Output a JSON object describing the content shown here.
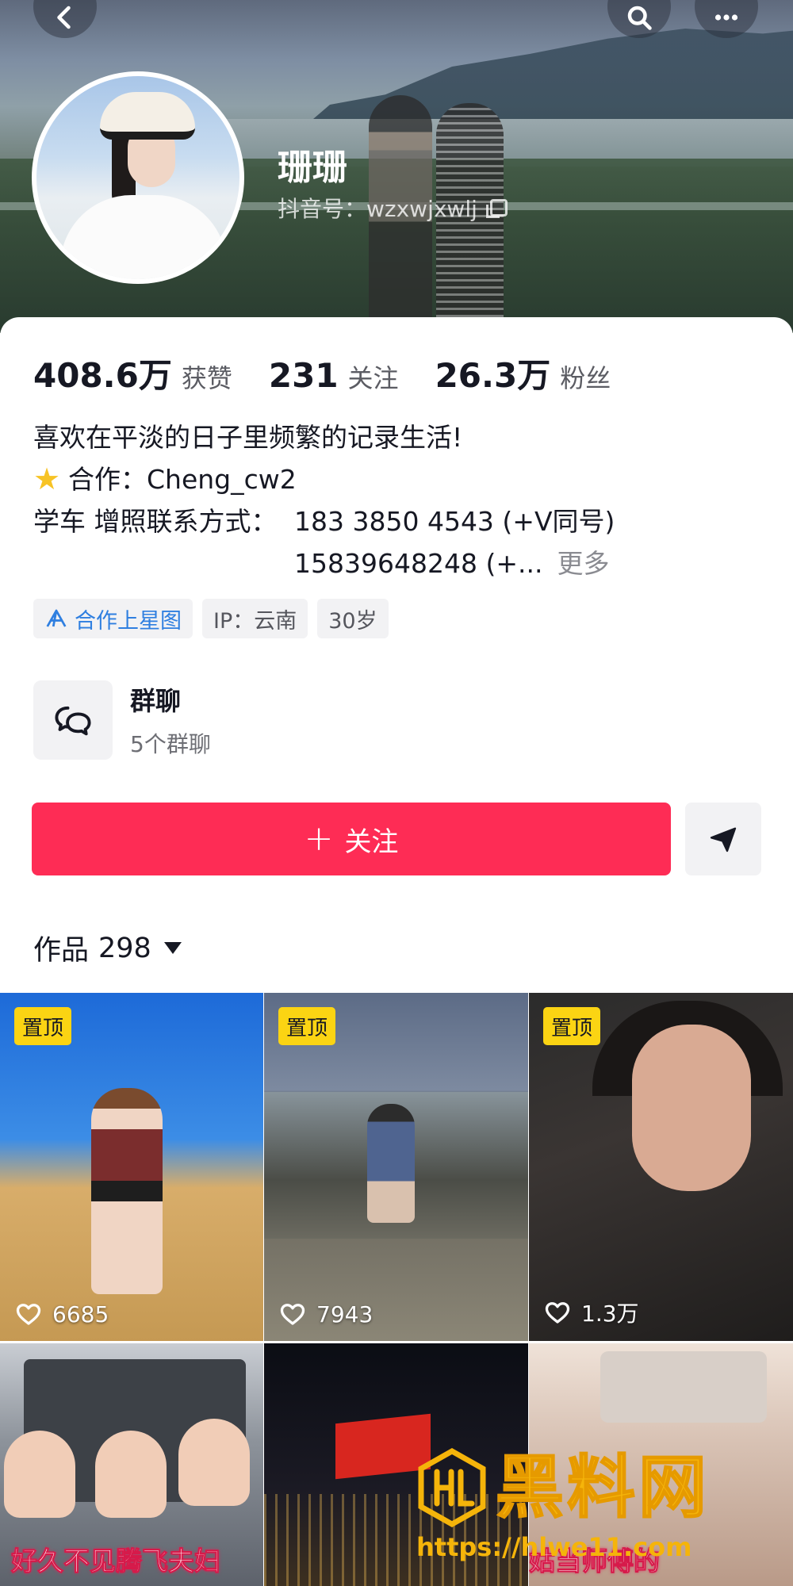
{
  "header": {
    "name": "珊珊",
    "handle": "抖音号：wzxwjxwlj"
  },
  "stats": [
    {
      "value": "408.6万",
      "label": "获赞"
    },
    {
      "value": "231",
      "label": "关注"
    },
    {
      "value": "26.3万",
      "label": "粉丝"
    }
  ],
  "bio": {
    "line1": "喜欢在平淡的日子里频繁的记录生活!",
    "coop": "合作：Cheng_cw2",
    "contact_label": "学车 增照联系方式：",
    "phone1": "183 3850 4543 (+V同号)",
    "phone2": "15839648248 (+...",
    "more": "更多"
  },
  "tags": {
    "xingtu": "合作上星图",
    "ip": "IP：云南",
    "age": "30岁"
  },
  "group_chat": {
    "title": "群聊",
    "subtitle": "5个群聊"
  },
  "actions": {
    "follow_label": "关注"
  },
  "works": {
    "label": "作品",
    "count": "298"
  },
  "videos": [
    {
      "pinned_label": "置顶",
      "likes": "6685"
    },
    {
      "pinned_label": "置顶",
      "likes": "7943"
    },
    {
      "pinned_label": "置顶",
      "likes": "1.3万"
    },
    {
      "caption": "好久不见腾飞夫妇"
    },
    {
      "caption": ""
    },
    {
      "caption": "姑当师傅的"
    }
  ],
  "watermark": {
    "text": "黑料网",
    "url": "https://hlwe11.com"
  },
  "colors": {
    "follow_button": "#fe2c55",
    "pinned_badge": "#fbd413",
    "tag_blue": "#2f7fe0",
    "watermark": "#f5b40a"
  }
}
